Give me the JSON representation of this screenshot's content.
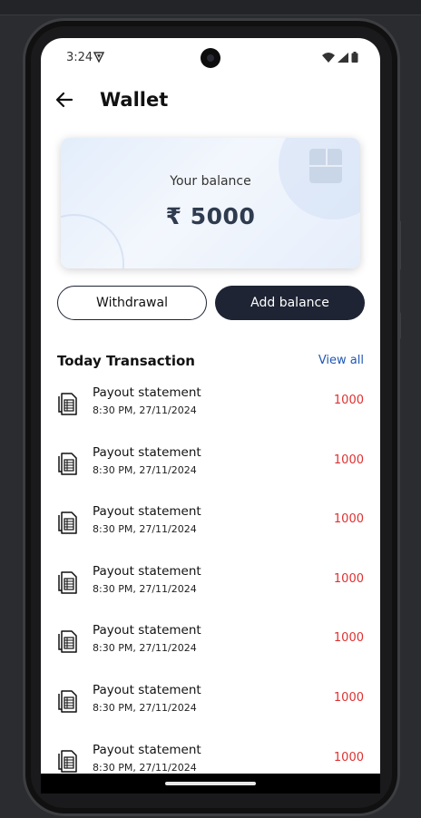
{
  "status_bar": {
    "time": "3:24"
  },
  "header": {
    "title": "Wallet"
  },
  "balance_card": {
    "label": "Your balance",
    "value": "₹ 5000"
  },
  "actions": {
    "withdraw_label": "Withdrawal",
    "add_label": "Add balance"
  },
  "transactions": {
    "section_title": "Today Transaction",
    "view_all_label": "View all",
    "items": [
      {
        "name": "Payout statement",
        "time": "8:30 PM, 27/11/2024",
        "amount": "1000"
      },
      {
        "name": "Payout statement",
        "time": "8:30 PM, 27/11/2024",
        "amount": "1000"
      },
      {
        "name": "Payout statement",
        "time": "8:30 PM, 27/11/2024",
        "amount": "1000"
      },
      {
        "name": "Payout statement",
        "time": "8:30 PM, 27/11/2024",
        "amount": "1000"
      },
      {
        "name": "Payout statement",
        "time": "8:30 PM, 27/11/2024",
        "amount": "1000"
      },
      {
        "name": "Payout statement",
        "time": "8:30 PM, 27/11/2024",
        "amount": "1000"
      },
      {
        "name": "Payout statement",
        "time": "8:30 PM, 27/11/2024",
        "amount": "1000"
      }
    ]
  },
  "colors": {
    "primary": "#1e2433",
    "link": "#1f57b5",
    "amount": "#e03131"
  },
  "icons": [
    "back-arrow-icon",
    "vpn-icon",
    "wifi-icon",
    "signal-icon",
    "battery-icon",
    "document-icon"
  ]
}
